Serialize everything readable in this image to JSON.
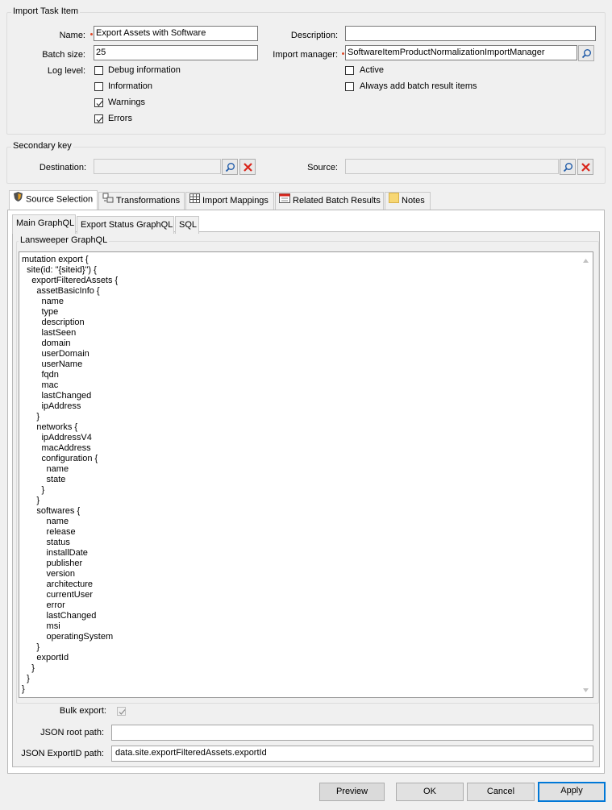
{
  "import_task": {
    "group_title": "Import Task Item",
    "name_label": "Name:",
    "name_value": "Export Assets with Software",
    "description_label": "Description:",
    "description_value": "",
    "batch_size_label": "Batch size:",
    "batch_size_value": "25",
    "import_manager_label": "Import manager:",
    "import_manager_value": "SoftwareItemProductNormalizationImportManager",
    "log_level_label": "Log level:",
    "log_levels": [
      {
        "label": "Debug information",
        "checked": false
      },
      {
        "label": "Information",
        "checked": false
      },
      {
        "label": "Warnings",
        "checked": true
      },
      {
        "label": "Errors",
        "checked": true
      }
    ],
    "options": [
      {
        "label": "Active",
        "checked": false
      },
      {
        "label": "Always add batch result items",
        "checked": false
      }
    ]
  },
  "secondary_key": {
    "group_title": "Secondary key",
    "destination_label": "Destination:",
    "destination_value": "",
    "source_label": "Source:",
    "source_value": ""
  },
  "tabs": [
    {
      "label": "Source Selection",
      "icon": "shield-icon",
      "active": true
    },
    {
      "label": "Transformations",
      "icon": "transform-icon",
      "active": false
    },
    {
      "label": "Import Mappings",
      "icon": "grid-icon",
      "active": false
    },
    {
      "label": "Related Batch Results",
      "icon": "batch-icon",
      "active": false
    },
    {
      "label": "Notes",
      "icon": "note-icon",
      "active": false
    }
  ],
  "subtabs": [
    {
      "label": "Main GraphQL",
      "active": true
    },
    {
      "label": "Export Status GraphQL",
      "active": false
    },
    {
      "label": "SQL",
      "active": false
    }
  ],
  "graphql": {
    "group_title": "Lansweeper GraphQL",
    "query": "mutation export {\n  site(id: \"{siteid}\") {\n    exportFilteredAssets {\n      assetBasicInfo {\n        name\n        type\n        description\n        lastSeen\n        domain\n        userDomain\n        userName\n        fqdn\n        mac\n        lastChanged\n        ipAddress\n      }\n      networks {\n        ipAddressV4\n        macAddress\n        configuration {\n          name\n          state\n        }\n      }\n      softwares {\n          name\n          release\n          status\n          installDate\n          publisher\n          version\n          architecture\n          currentUser\n          error\n          lastChanged\n          msi\n          operatingSystem\n      }\n      exportId\n    }\n  }\n}"
  },
  "export": {
    "bulk_export_label": "Bulk export:",
    "bulk_export_checked": true,
    "json_root_label": "JSON root path:",
    "json_root_value": "",
    "json_exportid_label": "JSON ExportID path:",
    "json_exportid_value": "data.site.exportFilteredAssets.exportId"
  },
  "buttons": {
    "preview": "Preview",
    "ok": "OK",
    "cancel": "Cancel",
    "apply": "Apply"
  },
  "colors": {
    "required_marker": "#e04a2a",
    "focus_border": "#0078d7",
    "delete_red": "#d9261c"
  }
}
